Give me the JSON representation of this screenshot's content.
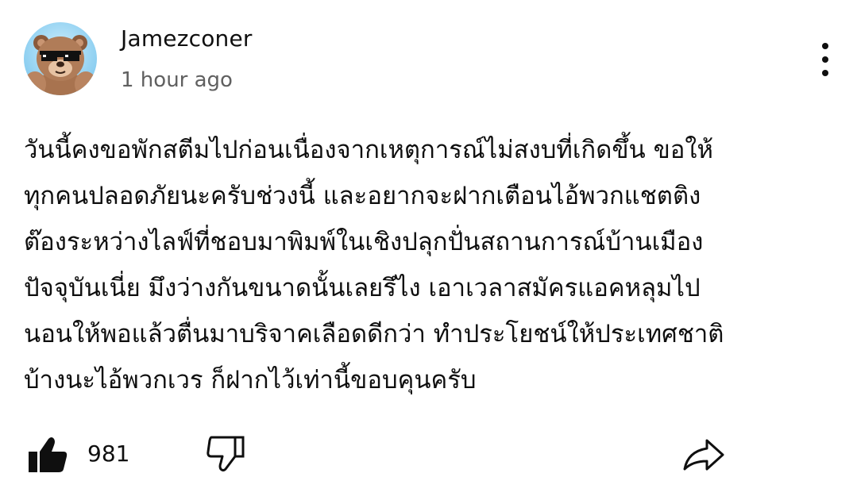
{
  "comment": {
    "author": "Jamezconer",
    "timestamp": "1 hour ago",
    "lines": [
      "วันนี้คงขอพักสตีมไปก่อนเนื่องจากเหตุการณ์ไม่สงบที่เกิดขึ้น ขอให้",
      "ทุกคนปลอดภัยนะครับช่วงนี้ และอยากจะฝากเตือนไอ้พวกแชตติง",
      "ต๊องระหว่างไลฟ์ที่ชอบมาพิมพ์ในเชิงปลุกปั่นสถานการณ์บ้านเมือง",
      "ปัจจุบันเนี่ย มึงว่างกันขนาดนั้นเลยรึไง เอาเวลาสมัครแอคหลุมไป",
      "นอนให้พอแล้วตื่นมาบริจาคเลือดดีกว่า ทำประโยชน์ให้ประเทศชาติ",
      "บ้างนะไอ้พวกเวร ก็ฝากไว้เท่านี้ขอบคุนครับ"
    ]
  },
  "actions": {
    "like_count": "981",
    "like_icon": "thumbs-up-filled-icon",
    "dislike_icon": "thumbs-down-outline-icon",
    "share_icon": "share-arrow-icon",
    "more_icon": "vertical-ellipsis-icon"
  }
}
